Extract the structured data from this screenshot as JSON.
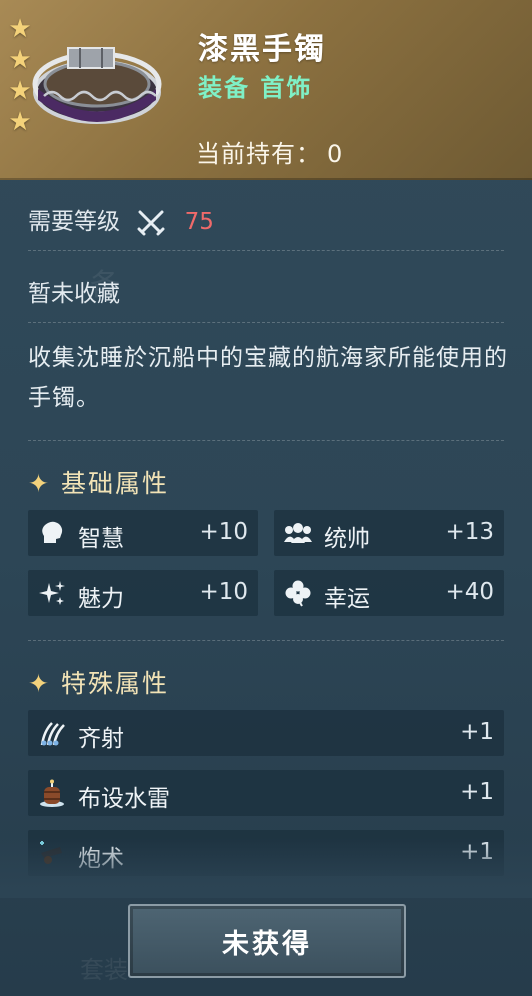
{
  "item": {
    "name": "漆黑手镯",
    "category": "装备 首饰",
    "owned_label": "当前持有：",
    "owned_count": "0",
    "stars": 4,
    "star_color": "#f4d27a"
  },
  "requirement": {
    "label": "需要等级",
    "icon": "crossed-swords-icon",
    "level": "75",
    "level_color": "#f06a6a"
  },
  "collection_status": "暂未收藏",
  "description": "收集沈睡於沉船中的宝藏的航海家所能使用的手镯。",
  "base_attributes": {
    "title": "基础属性",
    "items": [
      {
        "icon": "head-icon",
        "label": "智慧",
        "value": "+10"
      },
      {
        "icon": "group-icon",
        "label": "统帅",
        "value": "+13"
      },
      {
        "icon": "sparkle-icon",
        "label": "魅力",
        "value": "+10"
      },
      {
        "icon": "clover-icon",
        "label": "幸运",
        "value": "+40"
      }
    ]
  },
  "special_attributes": {
    "title": "特殊属性",
    "items": [
      {
        "icon": "volley-icon",
        "label": "齐射",
        "value": "+1"
      },
      {
        "icon": "mine-barrel-icon",
        "label": "布设水雷",
        "value": "+1"
      },
      {
        "icon": "cannon-icon",
        "label": "炮术",
        "value": "+1"
      }
    ]
  },
  "action": {
    "label": "未获得"
  }
}
